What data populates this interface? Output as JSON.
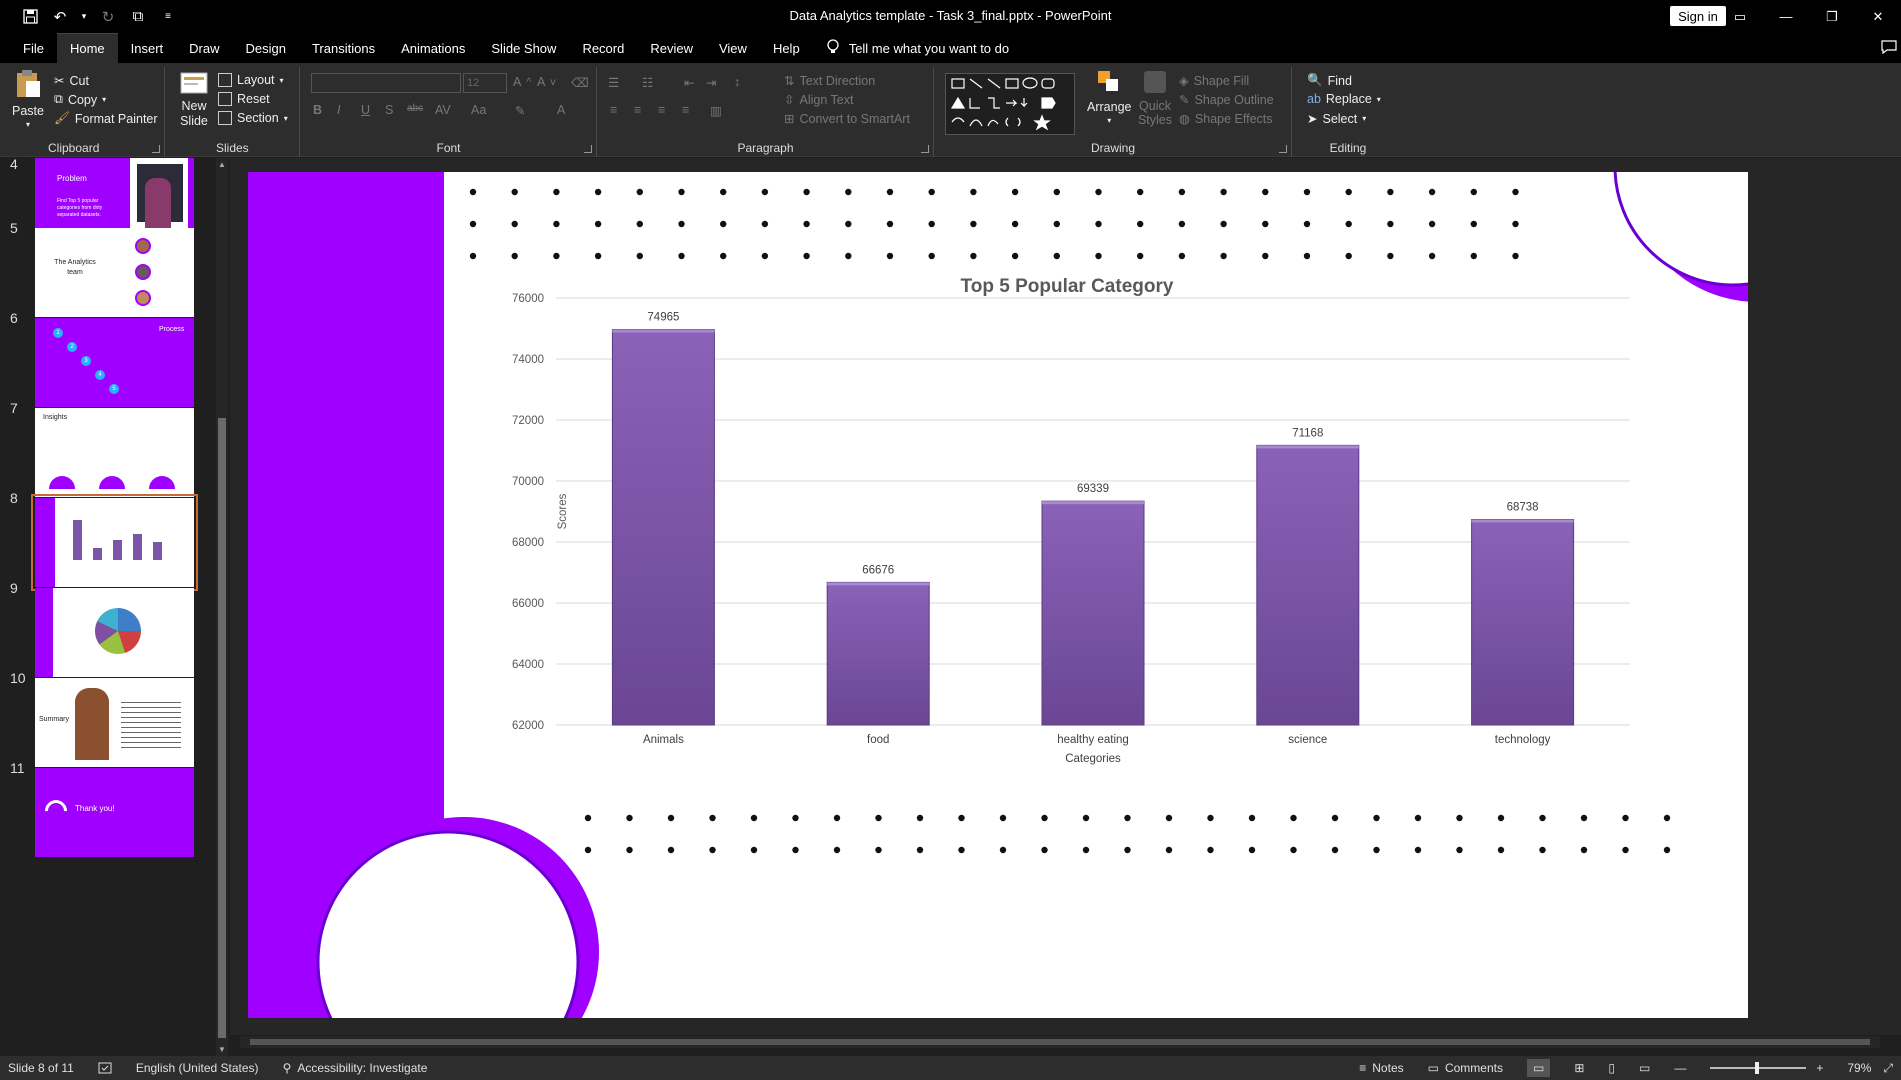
{
  "window": {
    "title": "Data Analytics template - Task 3_final.pptx  -  PowerPoint",
    "sign_in": "Sign in"
  },
  "menu": {
    "tabs": [
      "File",
      "Home",
      "Insert",
      "Draw",
      "Design",
      "Transitions",
      "Animations",
      "Slide Show",
      "Record",
      "Review",
      "View",
      "Help"
    ],
    "active": "Home",
    "tell_me": "Tell me what you want to do"
  },
  "ribbon": {
    "clipboard": {
      "label": "Clipboard",
      "paste": "Paste",
      "cut": "Cut",
      "copy": "Copy",
      "format_painter": "Format Painter"
    },
    "slides": {
      "label": "Slides",
      "new_slide": "New Slide",
      "layout": "Layout",
      "reset": "Reset",
      "section": "Section"
    },
    "font": {
      "label": "Font",
      "size": "12"
    },
    "paragraph": {
      "label": "Paragraph",
      "text_direction": "Text Direction",
      "align_text": "Align Text",
      "convert_smartart": "Convert to SmartArt"
    },
    "drawing": {
      "label": "Drawing",
      "arrange": "Arrange",
      "quick_styles": "Quick Styles",
      "shape_fill": "Shape Fill",
      "shape_outline": "Shape Outline",
      "shape_effects": "Shape Effects"
    },
    "editing": {
      "label": "Editing",
      "find": "Find",
      "replace": "Replace",
      "select": "Select"
    }
  },
  "thumbnails": {
    "slides": [
      {
        "num": "4",
        "text": "Problem",
        "sub": "Find Top 5 popular categories from dirty separated datasets."
      },
      {
        "num": "5",
        "text": "The Analytics team"
      },
      {
        "num": "6",
        "text": "Process",
        "steps": [
          "1",
          "2",
          "3",
          "4",
          "5"
        ]
      },
      {
        "num": "7",
        "text": "Insights"
      },
      {
        "num": "8"
      },
      {
        "num": "9"
      },
      {
        "num": "10",
        "text": "Summary"
      },
      {
        "num": "11",
        "text": "Thank you!"
      }
    ],
    "selected": "8"
  },
  "chart_data": {
    "type": "bar",
    "title": "Top 5 Popular Category",
    "xlabel": "Categories",
    "ylabel": "Scores",
    "categories": [
      "Animals",
      "food",
      "healthy eating",
      "science",
      "technology"
    ],
    "values": [
      74965,
      66676,
      69339,
      71168,
      68738
    ],
    "ylim": [
      62000,
      76000
    ],
    "yticks": [
      "62000",
      "64000",
      "66000",
      "68000",
      "70000",
      "72000",
      "74000",
      "76000"
    ],
    "bar_color": "#7b55a8",
    "grid": true,
    "legend": "none"
  },
  "colors": {
    "accent_purple": "#a000ff",
    "ribbon_bg": "#2d2d2d",
    "title_bg": "#000000"
  },
  "status": {
    "slide": "Slide 8 of 11",
    "language": "English (United States)",
    "accessibility": "Accessibility: Investigate",
    "notes": "Notes",
    "comments": "Comments",
    "zoom": "79%"
  }
}
